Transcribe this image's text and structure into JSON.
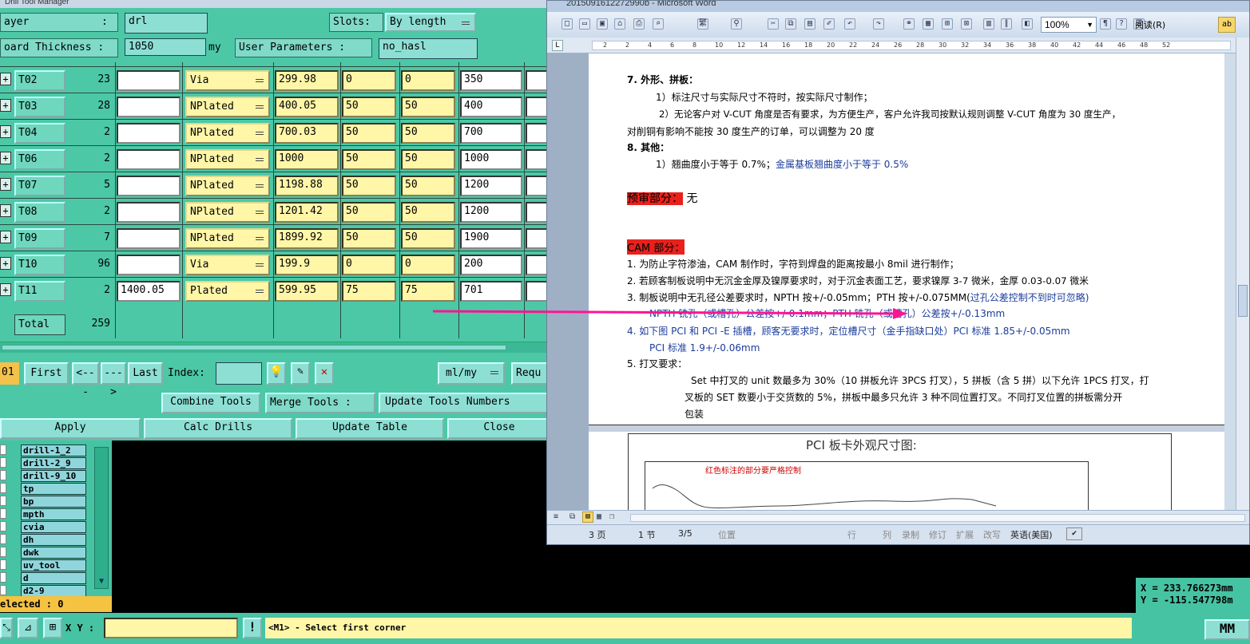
{
  "dtm": {
    "title": "Drill Tool Manager",
    "layer_label": "ayer",
    "layer_sep": ":",
    "layer_value": "drl",
    "slots_label": "Slots:",
    "slots_value": "By length",
    "thickness_label": "oard Thickness :",
    "thickness_value": "1050",
    "thickness_unit": "my",
    "user_params_label": "User Parameters :",
    "user_params_value": "no_hasl",
    "rows": [
      {
        "tool": "T02",
        "count": "23",
        "c1": "",
        "type": "Via",
        "v1": "299.98",
        "v2": "0",
        "v3": "0",
        "v4": "350"
      },
      {
        "tool": "T03",
        "count": "28",
        "c1": "",
        "type": "NPlated",
        "v1": "400.05",
        "v2": "50",
        "v3": "50",
        "v4": "400"
      },
      {
        "tool": "T04",
        "count": "2",
        "c1": "",
        "type": "NPlated",
        "v1": "700.03",
        "v2": "50",
        "v3": "50",
        "v4": "700"
      },
      {
        "tool": "T06",
        "count": "2",
        "c1": "",
        "type": "NPlated",
        "v1": "1000",
        "v2": "50",
        "v3": "50",
        "v4": "1000"
      },
      {
        "tool": "T07",
        "count": "5",
        "c1": "",
        "type": "NPlated",
        "v1": "1198.88",
        "v2": "50",
        "v3": "50",
        "v4": "1200"
      },
      {
        "tool": "T08",
        "count": "2",
        "c1": "",
        "type": "NPlated",
        "v1": "1201.42",
        "v2": "50",
        "v3": "50",
        "v4": "1200"
      },
      {
        "tool": "T09",
        "count": "7",
        "c1": "",
        "type": "NPlated",
        "v1": "1899.92",
        "v2": "50",
        "v3": "50",
        "v4": "1900"
      },
      {
        "tool": "T10",
        "count": "96",
        "c1": "",
        "type": "Via",
        "v1": "199.9",
        "v2": "0",
        "v3": "0",
        "v4": "200"
      },
      {
        "tool": "T11",
        "count": "2",
        "c1": "1400.05",
        "type": "Plated",
        "v1": "599.95",
        "v2": "75",
        "v3": "75",
        "v4": "701"
      }
    ],
    "total_label": "Total",
    "total_value": "259",
    "nav": {
      "page": "01",
      "first": "First",
      "prev": "<---",
      "next": "--->",
      "last": "Last",
      "index_label": "Index:",
      "units": "ml/my",
      "requ": "Requ"
    },
    "combine_tools": "Combine Tools",
    "merge_tools": "Merge Tools :",
    "update_tools_numbers": "Update Tools Numbers",
    "apply": "Apply",
    "calc_drills": "Calc Drills",
    "update_table": "Update Table",
    "close": "Close"
  },
  "layers": {
    "items": [
      "drill-1_2",
      "drill-2_9",
      "drill-9_10",
      "tp",
      "bp",
      "mpth",
      "cvia",
      "dh",
      "dwk",
      "uv_tool",
      "d",
      "d2-9"
    ],
    "selected": "elected : 0"
  },
  "bottom": {
    "xy_label": "X Y :",
    "message": "<M1> - Select first corner",
    "coord_x": "X = 233.766273mm",
    "coord_y": "Y = -115.547798m",
    "units": "MM"
  },
  "word": {
    "title": "2015091612272990b - Microsoft Word",
    "zoom": "100%",
    "reading": "阅读(R)",
    "ruler": [
      "2",
      "2",
      "4",
      "6",
      "8",
      "10",
      "12",
      "14",
      "16",
      "18",
      "20",
      "22",
      "24",
      "26",
      "28",
      "30",
      "32",
      "34",
      "36",
      "38",
      "40",
      "42",
      "44",
      "46",
      "48",
      "52"
    ],
    "lines": {
      "h7": "7.   外形、拼板：",
      "l7a": "1）标注尺寸与实际尺寸不符时，按实际尺寸制作；",
      "l7b": "2）无论客户对 V-CUT 角度是否有要求，为方便生产，客户允许我司按默认规则调整 V-CUT 角度为 30 度生产，",
      "l7c": "对削铜有影响不能按 30 度生产的订单，可以调整为 20 度",
      "h8": "8.   其他：",
      "l8a": "1）翘曲度小于等于 0.7%；",
      "l8a_blue": "金属基板翘曲度小于等于 0.5%",
      "pre_title": "预审部分：",
      "pre_value": " 无",
      "cam_title": "CAM 部分：",
      "c1": "1.   为防止字符渗油，CAM 制作时，字符到焊盘的距离按最小 8mil 进行制作；",
      "c2": "2.   若顾客制板说明中无沉金金厚及镍厚要求时，对于沉金表面工艺，要求镍厚 3-7 微米，金厚 0.03-0.07 微米",
      "c3": "3.   制板说明中无孔径公差要求时，NPTH 按+/-0.05mm；PTH 按+/-0.075MM(",
      "c3_blue": "过孔公差控制不到时可忽略)",
      "c3b": "NPTH 铣孔（或槽孔）公差按+/-0.1mm；PTH 铣孔（或槽孔）公差按+/-0.13mm",
      "c4": "4.   如下图 PCI 和 PCI -E 插槽，顾客无要求时，定位槽尺寸（金手指缺口处）PCI 标准 1.85+/-0.05mm",
      "c4b": "PCI 标准 1.9+/-0.06mm",
      "c5": "5.   打叉要求：",
      "c5a": "Set 中打叉的 unit 数最多为 30%（10 拼板允许 3PCS 打叉），5 拼板（含 5 拼）以下允许 1PCS 打叉，打",
      "c5b": "叉板的 SET 数要小于交货数的 5%，拼板中最多只允许 3 种不同位置打叉。不同打叉位置的拼板需分开",
      "c5c": "包装",
      "pci_title": "PCI 板卡外观尺寸图:",
      "pci_note": "红色标注的部分要严格控制"
    },
    "status": {
      "page": "3 页",
      "section": "1 节",
      "pages": "3/5",
      "pos": "位置",
      "line": "行",
      "col": "列",
      "rec": "录制",
      "rev": "修订",
      "ext": "扩展",
      "ovr": "改写",
      "lang": "英语(美国)"
    }
  }
}
